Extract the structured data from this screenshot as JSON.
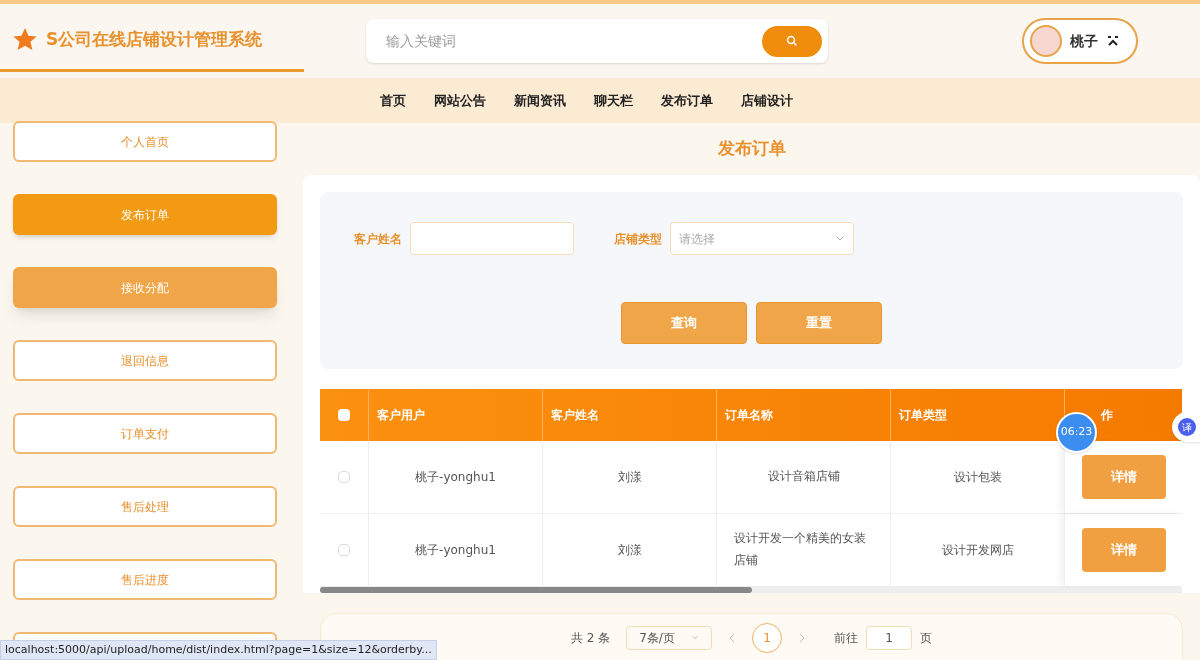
{
  "header": {
    "logo": "S公司在线店铺设计管理系统",
    "search": {
      "placeholder": "输入关键词"
    },
    "user": {
      "name": "桃子"
    }
  },
  "nav": [
    {
      "label": "首页"
    },
    {
      "label": "网站公告"
    },
    {
      "label": "新闻资讯"
    },
    {
      "label": "聊天栏"
    },
    {
      "label": "发布订单"
    },
    {
      "label": "店铺设计"
    }
  ],
  "sidebar": {
    "items": [
      {
        "label": "个人首页",
        "selected": false,
        "hovered": false
      },
      {
        "label": "发布订单",
        "selected": true,
        "hovered": false
      },
      {
        "label": "接收分配",
        "selected": false,
        "hovered": true
      },
      {
        "label": "退回信息",
        "selected": false,
        "hovered": false
      },
      {
        "label": "订单支付",
        "selected": false,
        "hovered": false
      },
      {
        "label": "售后处理",
        "selected": false,
        "hovered": false
      },
      {
        "label": "售后进度",
        "selected": false,
        "hovered": false
      }
    ]
  },
  "page_title": "发布订单",
  "filters": [
    {
      "kind": "text",
      "label": "客户姓名"
    },
    {
      "kind": "select",
      "label": "店铺类型",
      "placeholder": "请选择"
    }
  ],
  "filter_buttons": [
    "查询",
    "重置"
  ],
  "table": {
    "select_all": {
      "checked": false
    },
    "columns": [
      "客户用户",
      "客户姓名",
      "订单名称",
      "订单类型",
      "作"
    ],
    "rows": [
      {
        "checked": false,
        "cells": [
          "桃子-yonghu1",
          "刘漾",
          "设计音箱店铺",
          "设计包装"
        ],
        "action": "详情"
      },
      {
        "checked": false,
        "cells": [
          "桃子-yonghu1",
          "刘漾",
          "设计开发一个精美的女装店铺",
          "设计开发网店"
        ],
        "action": "详情"
      }
    ]
  },
  "pagination": {
    "total": "共 2 条",
    "page_size": "7条/页",
    "pages": [
      {
        "label": "1",
        "selected": true
      }
    ],
    "goto_label": "前往",
    "goto_value": "1",
    "goto_suffix": "页"
  },
  "timer_badge": "06:23",
  "translate_button": "译",
  "status_bar": "localhost:5000/api/upload/home/dist/index.html?page=1&size=12&orderby..."
}
